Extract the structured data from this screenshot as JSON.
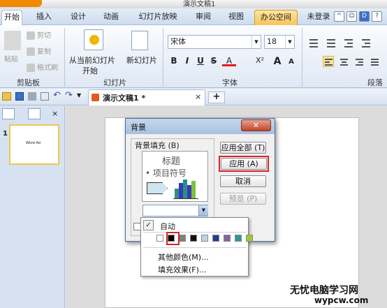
{
  "window": {
    "title": "演示文稿1"
  },
  "tabs": [
    {
      "label": "开始",
      "active": true
    },
    {
      "label": "插入"
    },
    {
      "label": "设计"
    },
    {
      "label": "动画"
    },
    {
      "label": "幻灯片放映"
    },
    {
      "label": "审阅"
    },
    {
      "label": "视图"
    },
    {
      "label": "办公空间",
      "special": true
    }
  ],
  "account": {
    "login_label": "未登录"
  },
  "ribbon": {
    "clipboard": {
      "paste": "粘贴",
      "cut": "剪切",
      "copy": "复制",
      "format_painter": "格式刷",
      "group": "剪贴板"
    },
    "slides": {
      "from_current_1": "从当前幻灯片",
      "from_current_2": "开始",
      "new_slide": "新幻灯片",
      "group": "幻灯片"
    },
    "font": {
      "font_name": "宋体",
      "font_size": "18",
      "group": "字体",
      "bold": "B",
      "italic": "I",
      "underline": "U",
      "strike": "S",
      "superscript": "X²",
      "grow": "A",
      "shrink": "A"
    },
    "paragraph": {
      "group": "段落"
    }
  },
  "doc_tab": {
    "label": "演示文稿1 *"
  },
  "slide_panel": {
    "slide_number": "1",
    "thumb_text": "Word Ad"
  },
  "dialog": {
    "title": "背景",
    "fill_group_label": "背景填充 (B)",
    "preview_title": "标题",
    "preview_bullet": "• 项目符号",
    "buttons": {
      "apply_all": "应用全部 (T)",
      "apply": "应用 (A)",
      "cancel": "取消",
      "preview": "预览 (P)"
    }
  },
  "color_dropdown": {
    "auto_label": "自动",
    "swatches": [
      "#ffffff",
      "#000000",
      "#7f7f7f",
      "#111111",
      "#bcd4e6",
      "#1f3f8f",
      "#8064a2",
      "#2a9a9a",
      "#9acd32"
    ],
    "more_colors": "其他颜色(M)...",
    "fill_effects": "填充效果(F)..."
  },
  "watermark": {
    "line1": "无忧电脑学习网",
    "line2": "wypcw.com"
  },
  "colors": {
    "accent_red": "#d8242a",
    "office_tab": "#f7c35a",
    "ribbon_blue": "#dfe8f4"
  }
}
